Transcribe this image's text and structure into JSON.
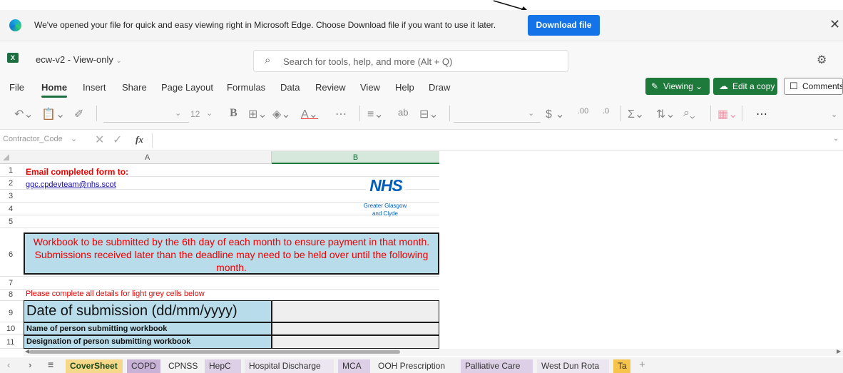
{
  "infobar": {
    "message": "We've opened your file for quick and easy viewing right in Microsoft Edge. Choose Download file if you want to use it later.",
    "download_label": "Download file",
    "close_glyph": "✕"
  },
  "app": {
    "doc_title": "ecw-v2 - View-only",
    "search_placeholder": "Search for tools, help, and more (Alt + Q)"
  },
  "menu": {
    "items": [
      "File",
      "Home",
      "Insert",
      "Share",
      "Page Layout",
      "Formulas",
      "Data",
      "Review",
      "View",
      "Help",
      "Draw"
    ],
    "viewing_label": "Viewing",
    "edit_copy_label": "Edit a copy",
    "comments_label": "Comments"
  },
  "ribbon": {
    "font_size": "12"
  },
  "formula_bar": {
    "name_box": "Contractor_Code",
    "fx": "fx"
  },
  "sheet": {
    "columns": [
      "A",
      "B"
    ],
    "row_numbers": [
      "1",
      "2",
      "3",
      "4",
      "5",
      "6",
      "7",
      "8",
      "9",
      "10",
      "11"
    ],
    "a1": "Email completed form to:",
    "a2": "ggc.cpdevteam@nhs.scot",
    "logo_word": "NHS",
    "logo_line1": "Greater Glasgow",
    "logo_line2": "and Clyde",
    "notice": "Workbook to be submitted by the 6th day of each month to ensure payment in that month. Submissions received later than the deadline may need to be held over until the following month.",
    "a8": "Please complete all details for light grey cells below",
    "a9": "Date of submission (dd/mm/yyyy)",
    "a10": "Name of person submitting workbook",
    "a11": "Designation of person submitting workbook"
  },
  "tabs": [
    {
      "label": "CoverSheet",
      "color": "#f6d88a",
      "active": true
    },
    {
      "label": "COPD",
      "color": "#c8b3d6"
    },
    {
      "label": "CPNSS",
      "color": "#f3f3f3"
    },
    {
      "label": "HepC",
      "color": "#ddd0e6"
    },
    {
      "label": "Hospital Discharge",
      "color": "#ece6f0"
    },
    {
      "label": "MCA",
      "color": "#ddd0e6"
    },
    {
      "label": "OOH Prescription",
      "color": "#f3f3f3"
    },
    {
      "label": "Palliative Care",
      "color": "#ddd0e6"
    },
    {
      "label": "West Dun Rota",
      "color": "#ece6f0"
    },
    {
      "label": "Ta",
      "color": "#f6c44a"
    }
  ],
  "colors": {
    "excel_green": "#1d7a3b",
    "edge_blue": "#1473e6",
    "notice_fill": "#b8dce9",
    "notice_text": "#ee0000",
    "input_fill": "#efefef"
  }
}
